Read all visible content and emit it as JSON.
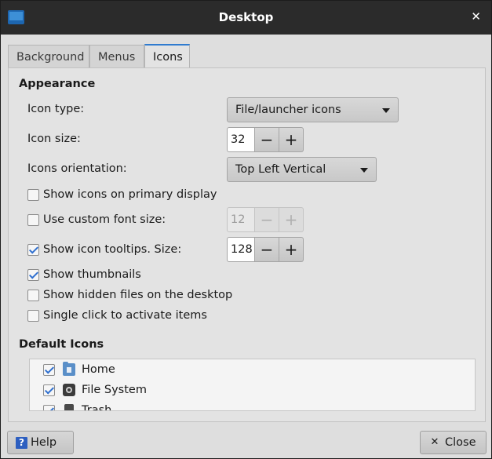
{
  "window": {
    "title": "Desktop",
    "close_glyph": "✕"
  },
  "tabs": [
    {
      "label": "Background",
      "active": false
    },
    {
      "label": "Menus",
      "active": false
    },
    {
      "label": "Icons",
      "active": true
    }
  ],
  "appearance": {
    "section_title": "Appearance",
    "icon_type": {
      "label": "Icon type:",
      "value": "File/launcher icons"
    },
    "icon_size": {
      "label": "Icon size:",
      "value": "32"
    },
    "orientation": {
      "label": "Icons orientation:",
      "value": "Top Left Vertical"
    },
    "primary_display": {
      "label": "Show icons on primary display",
      "checked": false
    },
    "custom_font": {
      "label": "Use custom font size:",
      "checked": false,
      "value": "12"
    },
    "tooltips": {
      "label": "Show icon tooltips. Size:",
      "checked": true,
      "value": "128"
    },
    "thumbnails": {
      "label": "Show thumbnails",
      "checked": true
    },
    "hidden_files": {
      "label": "Show hidden files on the desktop",
      "checked": false
    },
    "single_click": {
      "label": "Single click to activate items",
      "checked": false
    }
  },
  "default_icons": {
    "section_title": "Default Icons",
    "items": [
      {
        "label": "Home",
        "checked": true,
        "icon": "home-folder-icon"
      },
      {
        "label": "File System",
        "checked": true,
        "icon": "drive-icon"
      },
      {
        "label": "Trash",
        "checked": true,
        "icon": "trash-icon"
      }
    ]
  },
  "spin": {
    "minus": "−",
    "plus": "+"
  },
  "buttons": {
    "help": "Help",
    "help_glyph": "?",
    "close": "Close",
    "close_glyph": "✕"
  }
}
